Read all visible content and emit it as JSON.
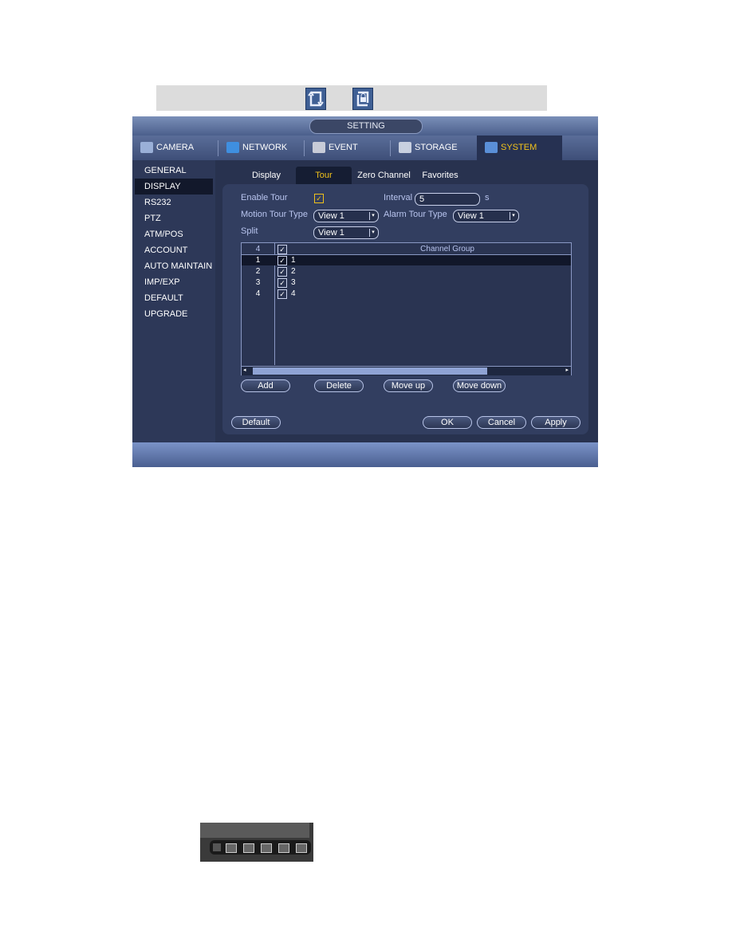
{
  "icon_bar": {
    "icons": [
      "tour-icon",
      "tour-lock-icon"
    ]
  },
  "window": {
    "title": "SETTING"
  },
  "main_tabs": [
    {
      "label": "CAMERA",
      "icon": "camera-icon"
    },
    {
      "label": "NETWORK",
      "icon": "network-icon"
    },
    {
      "label": "EVENT",
      "icon": "event-icon"
    },
    {
      "label": "STORAGE",
      "icon": "storage-icon"
    },
    {
      "label": "SYSTEM",
      "icon": "system-icon",
      "selected": true
    }
  ],
  "sidebar": {
    "items": [
      {
        "label": "GENERAL"
      },
      {
        "label": "DISPLAY",
        "selected": true
      },
      {
        "label": "RS232"
      },
      {
        "label": "PTZ"
      },
      {
        "label": "ATM/POS"
      },
      {
        "label": "ACCOUNT"
      },
      {
        "label": "AUTO MAINTAIN"
      },
      {
        "label": "IMP/EXP"
      },
      {
        "label": "DEFAULT"
      },
      {
        "label": "UPGRADE"
      }
    ]
  },
  "sub_tabs": [
    {
      "label": "Display"
    },
    {
      "label": "Tour",
      "selected": true
    },
    {
      "label": "Zero Channel"
    },
    {
      "label": "Favorites"
    }
  ],
  "form": {
    "enable_tour_label": "Enable Tour",
    "enable_tour_checked": true,
    "interval_label": "Interval",
    "interval_value": "5",
    "interval_unit": "s",
    "motion_tour_label": "Motion Tour Type",
    "motion_tour_value": "View 1",
    "alarm_tour_label": "Alarm Tour Type",
    "alarm_tour_value": "View 1",
    "split_label": "Split",
    "split_value": "View 1"
  },
  "table": {
    "header_count": "4",
    "header_title": "Channel Group",
    "rows": [
      {
        "index": "1",
        "group": "1",
        "selected": true
      },
      {
        "index": "2",
        "group": "2"
      },
      {
        "index": "3",
        "group": "3"
      },
      {
        "index": "4",
        "group": "4"
      }
    ]
  },
  "buttons": {
    "add": "Add",
    "delete": "Delete",
    "move_up": "Move up",
    "move_down": "Move down",
    "default": "Default",
    "ok": "OK",
    "cancel": "Cancel",
    "apply": "Apply"
  },
  "colors": {
    "accent": "#f1c21b",
    "panel": "#323e60"
  }
}
